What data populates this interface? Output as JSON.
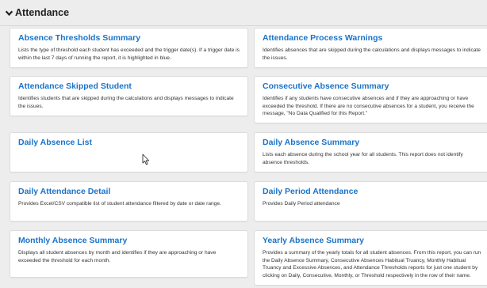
{
  "section": {
    "title": "Attendance",
    "icon": "chevron-down-icon"
  },
  "reports": [
    {
      "title": "Absence Thresholds Summary",
      "description": "Lists the type of threshold each student has exceeded and the trigger date(s). If a trigger date is within the last 7 days of running the report, it is highlighted in blue."
    },
    {
      "title": "Attendance Process Warnings",
      "description": "Identifies absences that are skipped during the calculations and displays messages to indicate the issues."
    },
    {
      "title": "Attendance Skipped Student",
      "description": "Identifies students that are skipped during the calculations and displays messages to indicate the issues."
    },
    {
      "title": "Consecutive Absence Summary",
      "description": "Identifies if any students have consecutive absences and if they are approaching or have exceeded the threshold. If there are no consecutive absences for a student, you receive the message, \"No Data Qualified for this Report.\""
    },
    {
      "title": "Daily Absence List",
      "description": ""
    },
    {
      "title": "Daily Absence Summary",
      "description": "Lists each absence during the school year for all students. This report does not identify absence thresholds."
    },
    {
      "title": "Daily Attendance Detail",
      "description": "Provides Excel/CSV compatible list of student attendance filtered by date or date range."
    },
    {
      "title": "Daily Period Attendance",
      "description": "Provides Daily Period attendance"
    },
    {
      "title": "Monthly Absence Summary",
      "description": "Displays all student absences by month and identifies if they are approaching or have exceeded the threshold for each month."
    },
    {
      "title": "Yearly Absence Summary",
      "description": "Provides a summary of the yearly totals for all student absences. From this report, you can run the Daily Absence Summary, Consecutive Absences Habitual Truancy, Monthly Habitual Truancy and Excessive Absences, and Attendance Thresholds reports for just one student by clicking on Daily, Consecutive, Monthly, or Threshold respectively in the row of their name."
    }
  ]
}
